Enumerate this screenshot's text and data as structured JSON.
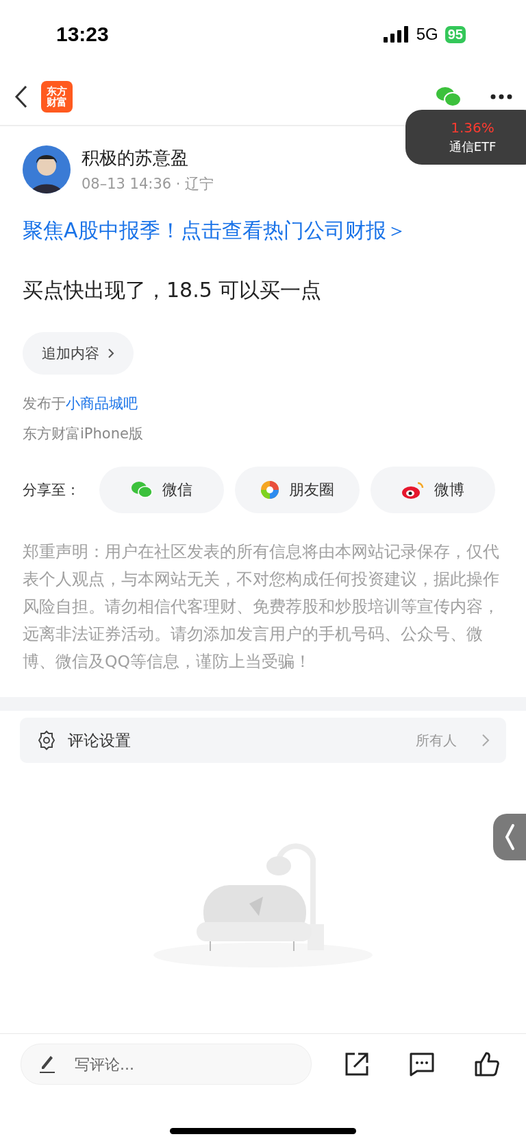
{
  "status_bar": {
    "time": "13:23",
    "network": "5G",
    "battery": "95"
  },
  "header": {
    "logo_lines": [
      "东方",
      "财富"
    ]
  },
  "floating_quote": {
    "change": "1.36%",
    "name": "通信ETF"
  },
  "post": {
    "author": "积极的苏意盈",
    "meta": "08–13 14:36 · 辽宁",
    "promo_link": "聚焦A股中报季！点击查看热门公司财报＞",
    "content": "买点快出现了，18.5 可以买一点",
    "append_button": "追加内容",
    "published_prefix": "发布于",
    "forum": "小商品城吧",
    "client": "东方财富iPhone版"
  },
  "share": {
    "label": "分享至：",
    "targets": [
      {
        "kind": "wechat",
        "label": "微信"
      },
      {
        "kind": "moments",
        "label": "朋友圈"
      },
      {
        "kind": "weibo",
        "label": "微博"
      }
    ]
  },
  "disclaimer": "郑重声明：用户在社区发表的所有信息将由本网站记录保存，仅代表个人观点，与本网站无关，不对您构成任何投资建议，据此操作风险自担。请勿相信代客理财、免费荐股和炒股培训等宣传内容，远离非法证券活动。请勿添加发言用户的手机号码、公众号、微博、微信及QQ等信息，谨防上当受骗！",
  "comment_settings": {
    "label": "评论设置",
    "value": "所有人"
  },
  "comment_bar": {
    "placeholder": "写评论..."
  }
}
